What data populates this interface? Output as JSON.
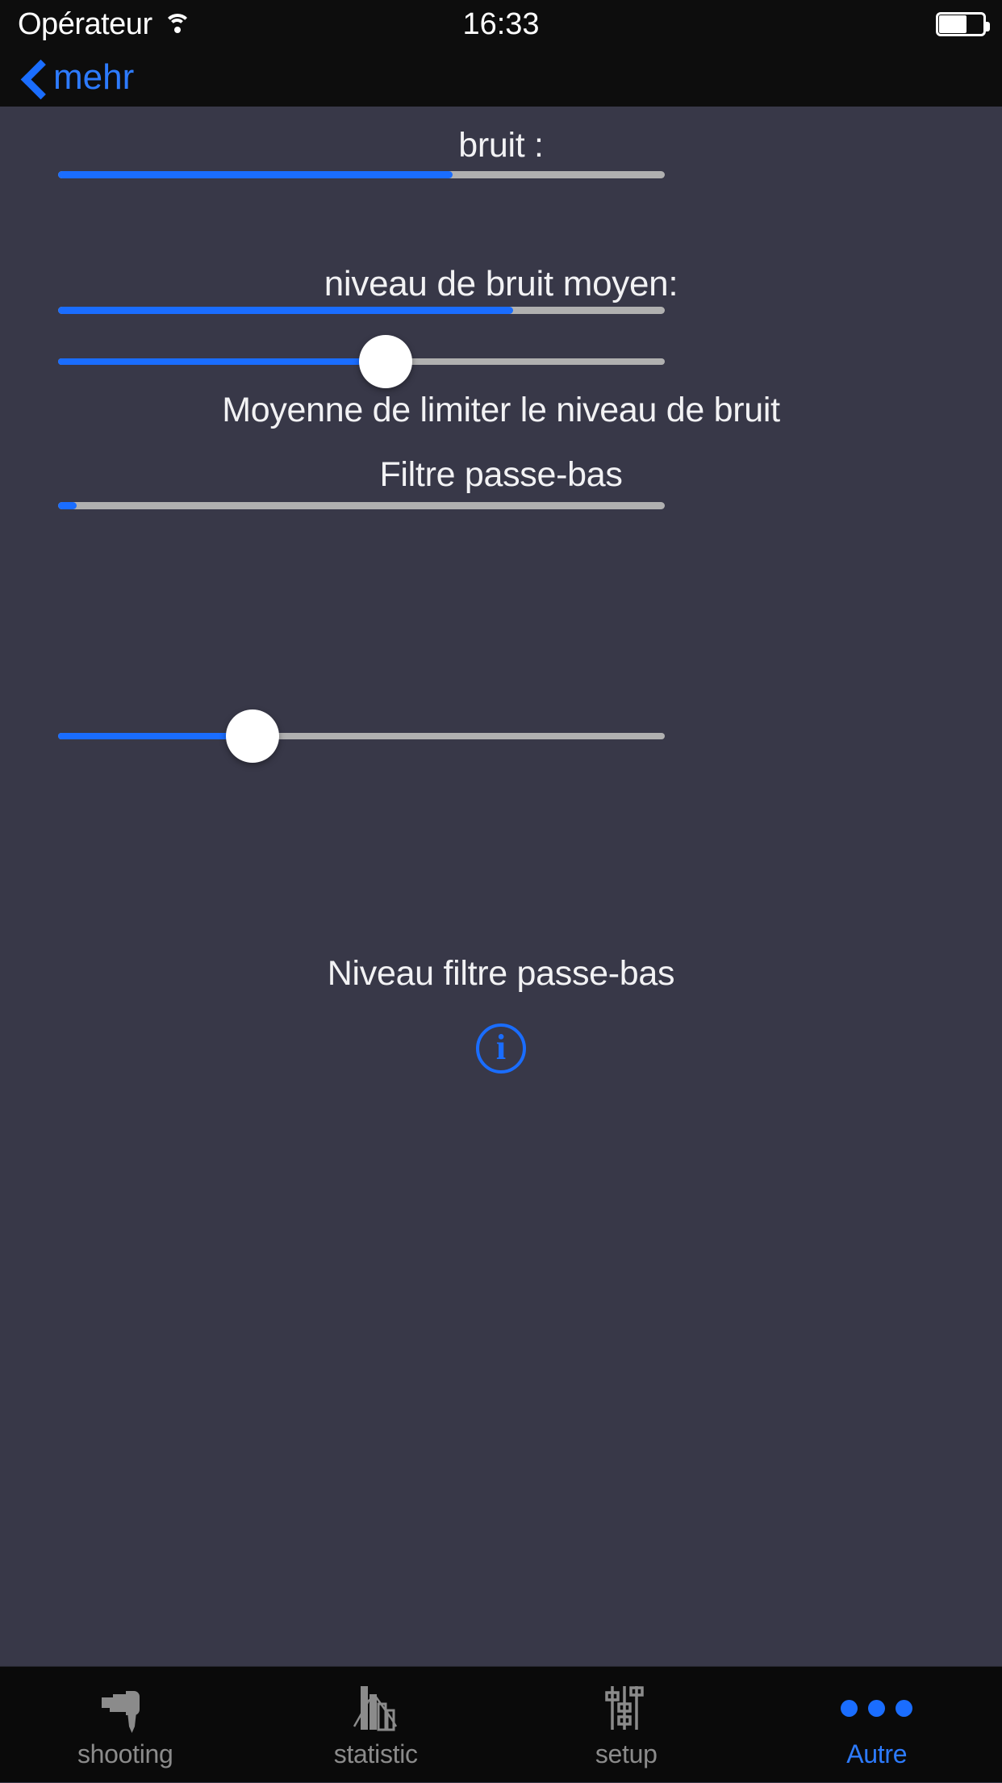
{
  "status_bar": {
    "carrier": "Opérateur",
    "time": "16:33",
    "wifi_icon": "wifi-icon",
    "battery_icon": "battery-icon"
  },
  "nav_bar": {
    "back_label": "mehr",
    "back_icon": "chevron-left-icon"
  },
  "content": {
    "noise_section": {
      "label": "bruit :",
      "progress_percent": 65
    },
    "avg_noise_section": {
      "label": "niveau de bruit moyen:",
      "progress_percent": 75,
      "slider_value_percent": 54,
      "slider_caption": "Moyenne de limiter le niveau de bruit"
    },
    "lowpass_section": {
      "label": "Filtre passe-bas",
      "progress_percent": 3,
      "slider_value_percent": 32,
      "slider_caption": "Niveau filtre passe-bas"
    },
    "info_button": {
      "icon": "info-circle-icon",
      "glyph": "i"
    }
  },
  "tab_bar": {
    "tabs": [
      {
        "label": "shooting",
        "icon": "pistol-icon",
        "active": false
      },
      {
        "label": "statistic",
        "icon": "bar-chart-icon",
        "active": false
      },
      {
        "label": "setup",
        "icon": "sliders-icon",
        "active": false
      },
      {
        "label": "Autre",
        "icon": "more-dots-icon",
        "active": true
      }
    ]
  },
  "colors": {
    "accent": "#1a6dff",
    "accent_text": "#2d7bff",
    "background": "#383848",
    "bar_track": "#b0b0b0",
    "chrome": "#0d0d0d",
    "tab_inactive": "#8b8b8b"
  }
}
